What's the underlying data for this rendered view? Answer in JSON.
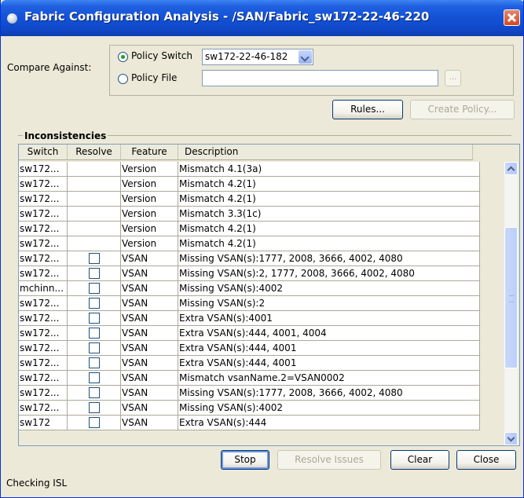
{
  "window": {
    "title": "Fabric Configuration Analysis - /SAN/Fabric_sw172-22-46-220"
  },
  "compare": {
    "label": "Compare Against:",
    "policy_switch_label": "Policy Switch",
    "policy_switch_value": "sw172-22-46-182",
    "policy_file_label": "Policy File",
    "policy_file_value": "",
    "browse_label": "...",
    "selected": "policy_switch"
  },
  "buttons": {
    "rules": "Rules...",
    "create_policy": "Create Policy...",
    "stop": "Stop",
    "resolve_issues": "Resolve Issues",
    "clear": "Clear",
    "close": "Close"
  },
  "inconsistencies": {
    "title": "Inconsistencies",
    "columns": [
      "Switch",
      "Resolve",
      "Feature",
      "Description"
    ],
    "rows": [
      {
        "switch": "sw172...",
        "resolve": false,
        "feature": "Version",
        "description": "Mismatch 4.1(3a)"
      },
      {
        "switch": "sw172...",
        "resolve": false,
        "feature": "Version",
        "description": "Mismatch 4.2(1)"
      },
      {
        "switch": "sw172...",
        "resolve": false,
        "feature": "Version",
        "description": "Mismatch 4.2(1)"
      },
      {
        "switch": "sw172...",
        "resolve": false,
        "feature": "Version",
        "description": "Mismatch 3.3(1c)"
      },
      {
        "switch": "sw172...",
        "resolve": false,
        "feature": "Version",
        "description": "Mismatch 4.2(1)"
      },
      {
        "switch": "sw172...",
        "resolve": false,
        "feature": "Version",
        "description": "Mismatch 4.2(1)"
      },
      {
        "switch": "sw172...",
        "resolve": true,
        "feature": "VSAN",
        "description": "Missing VSAN(s):1777, 2008, 3666, 4002, 4080"
      },
      {
        "switch": "sw172...",
        "resolve": true,
        "feature": "VSAN",
        "description": "Missing VSAN(s):2, 1777, 2008, 3666, 4002, 4080"
      },
      {
        "switch": "mchinn...",
        "resolve": true,
        "feature": "VSAN",
        "description": "Missing VSAN(s):4002"
      },
      {
        "switch": "sw172...",
        "resolve": true,
        "feature": "VSAN",
        "description": "Missing VSAN(s):2"
      },
      {
        "switch": "sw172...",
        "resolve": true,
        "feature": "VSAN",
        "description": "Extra VSAN(s):4001"
      },
      {
        "switch": "sw172...",
        "resolve": true,
        "feature": "VSAN",
        "description": "Extra VSAN(s):444, 4001, 4004"
      },
      {
        "switch": "sw172...",
        "resolve": true,
        "feature": "VSAN",
        "description": "Extra VSAN(s):444, 4001"
      },
      {
        "switch": "sw172...",
        "resolve": true,
        "feature": "VSAN",
        "description": "Extra VSAN(s):444, 4001"
      },
      {
        "switch": "sw172...",
        "resolve": true,
        "feature": "VSAN",
        "description": "Mismatch vsanName.2=VSAN0002"
      },
      {
        "switch": "sw172...",
        "resolve": true,
        "feature": "VSAN",
        "description": "Missing VSAN(s):1777, 2008, 3666, 4002, 4080"
      },
      {
        "switch": "sw172...",
        "resolve": true,
        "feature": "VSAN",
        "description": "Missing VSAN(s):4002"
      },
      {
        "switch": "sw172",
        "resolve": true,
        "feature": "VSAN",
        "description": "Extra VSAN(s):444"
      }
    ]
  },
  "status": {
    "text": "Checking ISL"
  }
}
